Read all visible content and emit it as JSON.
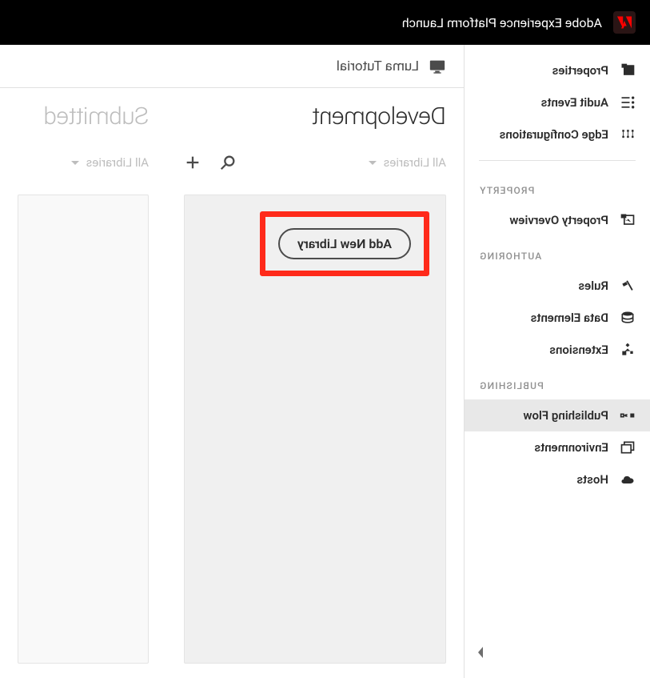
{
  "header": {
    "title": "Adobe Experience Platform Launch"
  },
  "sidebar": {
    "top": [
      {
        "label": "Properties",
        "icon": "properties"
      },
      {
        "label": "Audit Events",
        "icon": "audit"
      },
      {
        "label": "Edge Configurations",
        "icon": "edge"
      }
    ],
    "sections": [
      {
        "label": "PROPERTY",
        "items": [
          {
            "label": "Property Overview",
            "icon": "overview"
          }
        ]
      },
      {
        "label": "AUTHORING",
        "items": [
          {
            "label": "Rules",
            "icon": "rules"
          },
          {
            "label": "Data Elements",
            "icon": "data"
          },
          {
            "label": "Extensions",
            "icon": "extensions"
          }
        ]
      },
      {
        "label": "PUBLISHING",
        "items": [
          {
            "label": "Publishing Flow",
            "icon": "publishing",
            "selected": true
          },
          {
            "label": "Environments",
            "icon": "environments"
          },
          {
            "label": "Hosts",
            "icon": "hosts"
          }
        ]
      }
    ]
  },
  "property": {
    "name": "Luma Tutorial"
  },
  "columns": {
    "development": {
      "title": "Development",
      "filter": "All Libraries",
      "add_button": "Add New Library"
    },
    "submitted": {
      "title": "Submitted",
      "filter": "All Libraries"
    }
  }
}
